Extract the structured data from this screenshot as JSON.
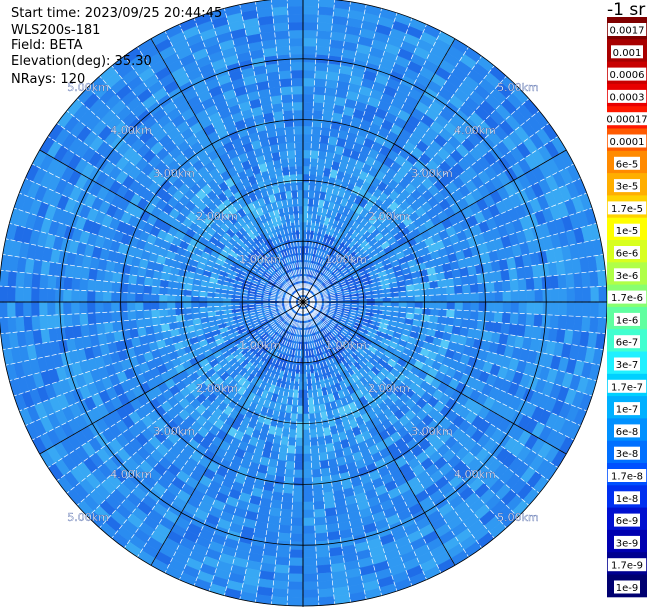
{
  "header": {
    "start_time": "Start time: 2023/09/25 20:44:45",
    "instrument": "WLS200s-181",
    "field": "Field: BETA",
    "elevation": "Elevation(deg): 35.30",
    "nrays": "NRays: 120"
  },
  "chart_data": {
    "type": "heatmap",
    "projection": "polar-ppi",
    "field": "BETA",
    "n_rays": 120,
    "range_rings_km": [
      1,
      2,
      3,
      4,
      5
    ],
    "ring_labels": [
      "1.00km",
      "2.00km",
      "3.00km",
      "4.00km",
      "5.00km"
    ],
    "spokes_deg": [
      0,
      30,
      60,
      90,
      120,
      150,
      180,
      210,
      240,
      270,
      300,
      330
    ],
    "max_range_km": 5.0,
    "colorbar": {
      "unit": "-1 sr",
      "labels": [
        "0.0017",
        "0.001",
        "0.0006",
        "0.0003",
        "0.00017",
        "0.0001",
        "6e-5",
        "3e-5",
        "1.7e-5",
        "1e-5",
        "6e-6",
        "3e-6",
        "1.7e-6",
        "1e-6",
        "6e-7",
        "3e-7",
        "1.7e-7",
        "1e-7",
        "6e-8",
        "3e-8",
        "1.7e-8",
        "1e-8",
        "6e-9",
        "3e-9",
        "1.7e-9",
        "1e-9"
      ],
      "colors": [
        "#800000",
        "#a80000",
        "#c80000",
        "#e80000",
        "#ff1800",
        "#ff5a00",
        "#ff8a00",
        "#ffae00",
        "#ffd200",
        "#ffff00",
        "#d8ff20",
        "#b0ff48",
        "#88ff70",
        "#60ffa0",
        "#40ffd0",
        "#20f0ff",
        "#00d0ff",
        "#00b0ff",
        "#0090ff",
        "#0070ff",
        "#0050ff",
        "#0030f0",
        "#0010d0",
        "#0000b0",
        "#000090",
        "#000070"
      ]
    },
    "colors": {
      "dominant": "#2a8cf0",
      "light": "#55c8f8",
      "dark": "#1a5ae0",
      "spoke_line": "#ffffff",
      "ring_line": "#000000"
    }
  }
}
